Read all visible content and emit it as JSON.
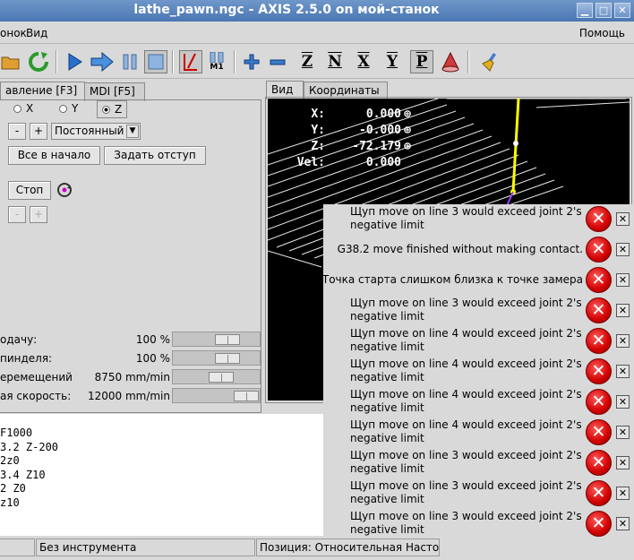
{
  "window": {
    "title": "lathe_pawn.ngc - AXIS 2.5.0 on мой-станок"
  },
  "menu": {
    "items": [
      "онок",
      "Вид"
    ],
    "help": "Помощь"
  },
  "toolbar": {
    "axis_z": "Z",
    "axis_n": "N",
    "axis_x": "X",
    "axis_y": "Y",
    "axis_p": "P",
    "m1": "M1"
  },
  "tabs": {
    "manual": "авление [F3]",
    "mdi": "MDI [F5]",
    "view": "Вид",
    "coords": "Координаты"
  },
  "manual": {
    "axes": [
      "X",
      "Y",
      "Z"
    ],
    "selected_axis": "Z",
    "minus": "-",
    "plus": "+",
    "jog_mode": "Постоянный",
    "home_all": "Все в начало",
    "touch_off": "Задать отступ",
    "stop": "Стоп"
  },
  "overrides": [
    {
      "label": "одачу:",
      "value": "100 %",
      "slider_fraction": 0.69
    },
    {
      "label": "пинделя:",
      "value": "100 %",
      "slider_fraction": 0.69
    },
    {
      "label": "еремещений",
      "value": "8750 mm/min",
      "slider_fraction": 0.58
    },
    {
      "label": "ая скорость:",
      "value": "12000 mm/min",
      "slider_fraction": 1.0
    }
  ],
  "dro": [
    {
      "axis": "X:",
      "value": "0.000"
    },
    {
      "axis": "Y:",
      "value": "-0.000"
    },
    {
      "axis": "Z:",
      "value": "-72.179"
    },
    {
      "axis": "Vel:",
      "value": "0.000"
    }
  ],
  "gcode": {
    "lines": [
      "F1000",
      "3.2 Z-200",
      "2z0",
      "3.4 Z10",
      "2 Z0",
      "z10"
    ]
  },
  "status": {
    "left": "",
    "tool": "Без инструмента",
    "position": "Позиция: Относительная Насто"
  },
  "errors": [
    {
      "text": "Щуп move on line 3 would exceed joint 2's negative limit"
    },
    {
      "text": "G38.2 move finished without making contact."
    },
    {
      "text": "Точка старта слишком близка к точке замера"
    },
    {
      "text": "Щуп move on line 3 would exceed joint 2's negative limit"
    },
    {
      "text": "Щуп move on line 4 would exceed joint 2's negative limit"
    },
    {
      "text": "Щуп move on line 4 would exceed joint 2's negative limit"
    },
    {
      "text": "Щуп move on line 4 would exceed joint 2's negative limit"
    },
    {
      "text": "Щуп move on line 4 would exceed joint 2's negative limit"
    },
    {
      "text": "Щуп move on line 3 would exceed joint 2's negative limit"
    },
    {
      "text": "Щуп move on line 3 would exceed joint 2's negative limit"
    },
    {
      "text": "Щуп move on line 3 would exceed joint 2's negative limit"
    }
  ]
}
